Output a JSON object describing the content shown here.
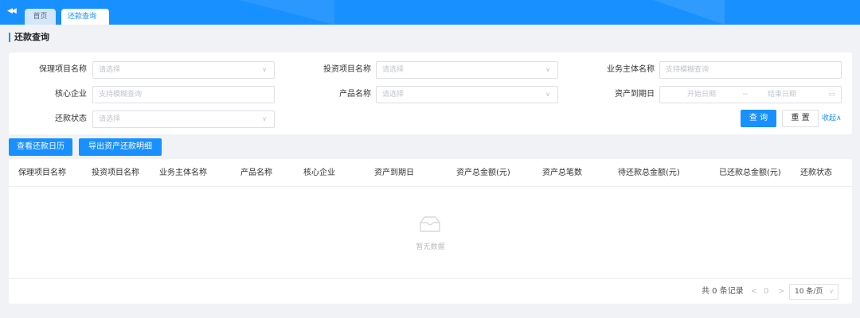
{
  "tabs": {
    "home": "首页",
    "active": "还款查询",
    "close_glyph": "×"
  },
  "page_title": "还款查询",
  "filters": {
    "factoring_project": {
      "label": "保理项目名称",
      "placeholder": "请选择"
    },
    "investment_project": {
      "label": "投资项目名称",
      "placeholder": "请选择"
    },
    "business_entity": {
      "label": "业务主体名称",
      "placeholder": "支持模糊查询"
    },
    "core_enterprise": {
      "label": "核心企业",
      "placeholder": "支持模糊查询"
    },
    "product_name": {
      "label": "产品名称",
      "placeholder": "请选择"
    },
    "asset_due_date": {
      "label": "资产到期日",
      "start_placeholder": "开始日期",
      "separator": "~",
      "end_placeholder": "结束日期"
    },
    "repay_status": {
      "label": "还款状态",
      "placeholder": "请选择"
    }
  },
  "buttons": {
    "query": "查 询",
    "reset": "重 置",
    "collapse": "收起∧",
    "view_calendar": "查看还款日历",
    "export_detail": "导出资产还款明细"
  },
  "table": {
    "columns": [
      "保理项目名称",
      "投资项目名称",
      "业务主体名称",
      "产品名称",
      "核心企业",
      "资产到期日",
      "资产总金额(元)",
      "资产总笔数",
      "待还款总金额(元)",
      "已还款总金额(元)",
      "还款状态"
    ],
    "empty_text": "暂无数据"
  },
  "pagination": {
    "total": "共 0 条记录",
    "prev": "<",
    "page": "0",
    "next": ">",
    "page_size": "10 条/页"
  },
  "colors": {
    "primary": "#1890ff",
    "background": "#f0f2f5",
    "border": "#dcdfe6"
  },
  "icons": {
    "collapse_sidebar": "double-chevron-left-icon",
    "select_arrow": "chevron-down-icon",
    "calendar": "calendar-icon",
    "empty": "empty-inbox-icon"
  }
}
